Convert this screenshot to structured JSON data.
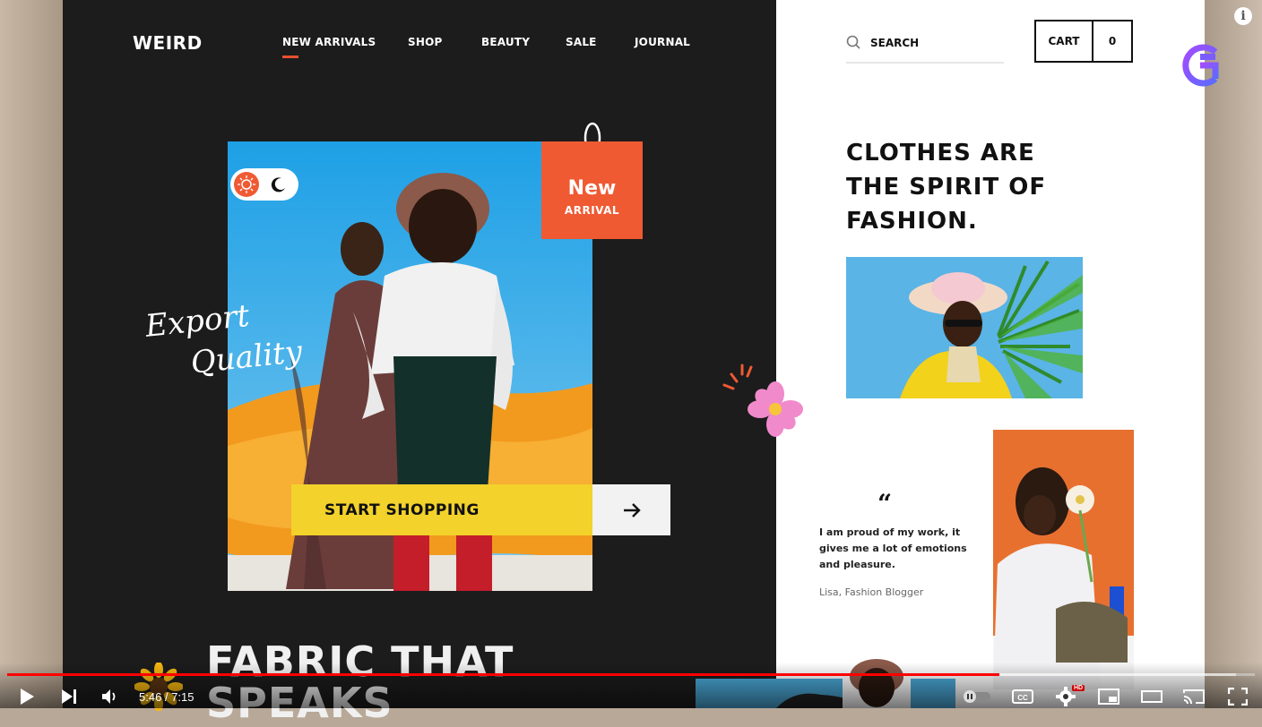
{
  "site": {
    "logo": "WEIRD",
    "nav": [
      {
        "label": "NEW ARRIVALS",
        "active": true
      },
      {
        "label": "SHOP"
      },
      {
        "label": "BEAUTY"
      },
      {
        "label": "SALE"
      },
      {
        "label": "JOURNAL"
      }
    ],
    "search_label": "SEARCH",
    "cart_label": "CART",
    "cart_count": "0"
  },
  "hero": {
    "tag_line1": "New",
    "tag_line2": "ARRIVAL",
    "script_line1": "Export",
    "script_line2": "Quality",
    "cta_label": "START SHOPPING",
    "cta_icon": "arrow-right-icon",
    "heading_line1": "FABRIC THAT",
    "heading_line2": "SPEAKS"
  },
  "right": {
    "headline_line1": "CLOTHES ARE",
    "headline_line2": "THE SPIRIT OF",
    "headline_line3": "FASHION.",
    "quote_mark": "“",
    "quote": "I am proud of my work, it gives me a lot of emotions and pleasure.",
    "author": "Lisa, Fashion Blogger"
  },
  "player": {
    "current_time": "5:46",
    "duration": "7:15",
    "time_display": "5:46 / 7:15",
    "progress": 0.795,
    "buffered": 0.985,
    "hd_label": "HD",
    "info_label": "i"
  },
  "colors": {
    "accent_orange": "#ef5a33",
    "cta_yellow": "#f2d22b",
    "dark_bg": "#1c1c1c",
    "progress_red": "#ff0000"
  }
}
